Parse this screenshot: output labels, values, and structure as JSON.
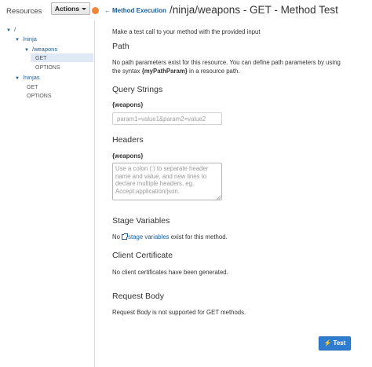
{
  "header": {
    "resources_title": "Resources",
    "actions_label": "Actions",
    "back_label": "Method Execution",
    "page_title": "/ninja/weapons - GET - Method Test",
    "accent_color": "#f58536",
    "link_color": "#1a5c96"
  },
  "tree": {
    "root": "/",
    "ninja": "/ninja",
    "weapons": "/weapons",
    "weapons_get": "GET",
    "weapons_options": "OPTIONS",
    "ninjas": "/ninjas",
    "ninjas_get": "GET",
    "ninjas_options": "OPTIONS",
    "selected": "GET"
  },
  "main": {
    "intro": "Make a test call to your method with the provided input",
    "path": {
      "title": "Path",
      "line1": "No path parameters exist for this resource. You can define path parameters by using",
      "line2_pre": "the syntax ",
      "line2_bold": "{myPathParam}",
      "line2_post": " in a resource path."
    },
    "query": {
      "title": "Query Strings",
      "label": "{weapons}",
      "placeholder": "param1=value1&param2=value2",
      "value": ""
    },
    "headers": {
      "title": "Headers",
      "label": "{weapons}",
      "placeholder": "Use a colon (:) to separate header name and value, and new lines to declare multiple headers. eg. Accept:application/json.",
      "value": ""
    },
    "stage": {
      "title": "Stage Variables",
      "pre": "No ",
      "link": "stage variables",
      "post": " exist for this method."
    },
    "cert": {
      "title": "Client Certificate",
      "text": "No client certificates have been generated."
    },
    "body": {
      "title": "Request Body",
      "text": "Request Body is not supported for GET methods."
    },
    "test_button": "Test",
    "button_color": "#2f7dd1"
  }
}
